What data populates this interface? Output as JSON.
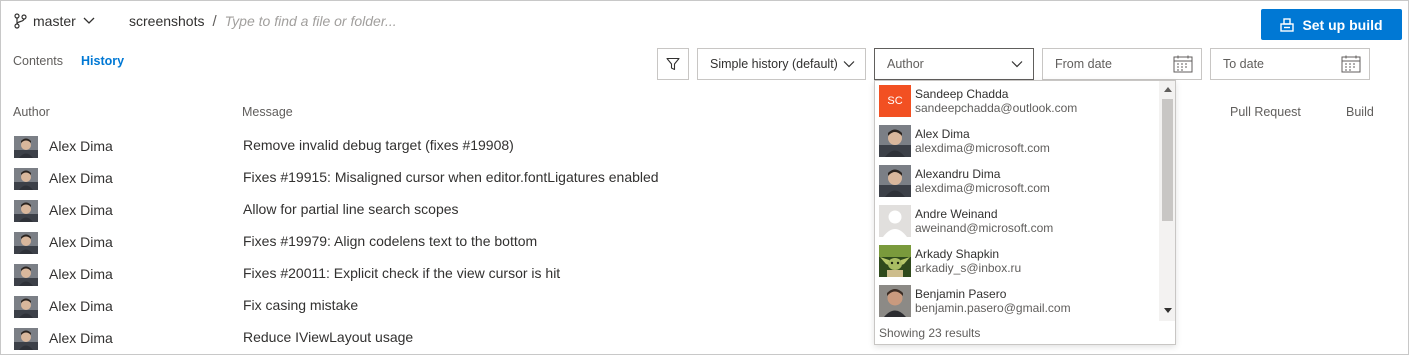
{
  "header": {
    "branch": "master",
    "repo": "screenshots",
    "separator": "/",
    "path_placeholder": "Type to find a file or folder...",
    "setup_build_label": "Set up build"
  },
  "tabs": [
    {
      "label": "Contents",
      "active": false
    },
    {
      "label": "History",
      "active": true
    }
  ],
  "filters": {
    "history_mode": "Simple history (default)",
    "author_placeholder": "Author",
    "from_date_placeholder": "From date",
    "to_date_placeholder": "To date"
  },
  "table": {
    "columns": {
      "author": "Author",
      "message": "Message",
      "pull_request": "Pull Request",
      "build": "Build"
    },
    "rows": [
      {
        "author": "Alex Dima",
        "message": "Remove invalid debug target (fixes #19908)"
      },
      {
        "author": "Alex Dima",
        "message": "Fixes #19915: Misaligned cursor when editor.fontLigatures enabled"
      },
      {
        "author": "Alex Dima",
        "message": "Allow for partial line search scopes"
      },
      {
        "author": "Alex Dima",
        "message": "Fixes #19979: Align codelens text to the bottom"
      },
      {
        "author": "Alex Dima",
        "message": "Fixes #20011: Explicit check if the view cursor is hit"
      },
      {
        "author": "Alex Dima",
        "message": "Fix casing mistake"
      },
      {
        "author": "Alex Dima",
        "message": "Reduce IViewLayout usage"
      }
    ]
  },
  "author_popup": {
    "items": [
      {
        "initials": "SC",
        "name": "Sandeep Chadda",
        "email": "sandeepchadda@outlook.com",
        "avatar": "initials"
      },
      {
        "name": "Alex Dima",
        "email": "alexdima@microsoft.com",
        "avatar": "photo"
      },
      {
        "name": "Alexandru Dima",
        "email": "alexdima@microsoft.com",
        "avatar": "photo"
      },
      {
        "name": "Andre Weinand",
        "email": "aweinand@microsoft.com",
        "avatar": "placeholder"
      },
      {
        "name": "Arkady Shapkin",
        "email": "arkadiy_s@inbox.ru",
        "avatar": "yoda"
      },
      {
        "name": "Benjamin Pasero",
        "email": "benjamin.pasero@gmail.com",
        "avatar": "photo"
      }
    ],
    "footer": "Showing 23 results"
  },
  "colors": {
    "accent": "#0078d4",
    "initials_avatar_bg": "#f25022",
    "text": "#323130",
    "muted_text": "#605e5c"
  },
  "icons": {
    "branch": "branch-icon",
    "chevron": "chevron-down-icon",
    "filter": "filter-icon",
    "calendar": "calendar-icon",
    "build": "build-icon"
  }
}
